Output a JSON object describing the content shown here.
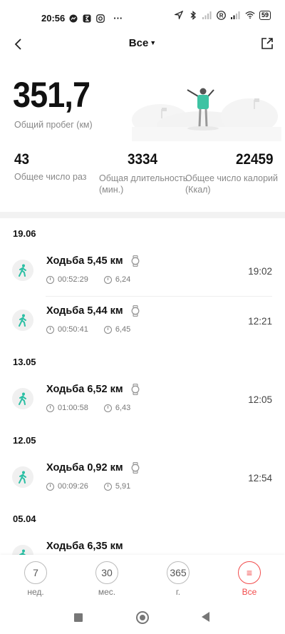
{
  "status_bar": {
    "time": "20:56",
    "more": "···",
    "battery": "59"
  },
  "header": {
    "title": "Все"
  },
  "summary": {
    "total_km": "351,7",
    "total_km_label": "Общий пробег (км)",
    "count": "43",
    "count_label": "Общее число раз",
    "duration": "3334",
    "duration_label": "Общая длительность (мин.)",
    "calories": "22459",
    "calories_label": "Общее число калорий (Ккал)"
  },
  "groups": [
    {
      "date": "19.06",
      "items": [
        {
          "title": "Ходьба 5,45 км",
          "duration": "00:52:29",
          "pace": "6,24",
          "time": "19:02"
        },
        {
          "title": "Ходьба 5,44 км",
          "duration": "00:50:41",
          "pace": "6,45",
          "time": "12:21"
        }
      ]
    },
    {
      "date": "13.05",
      "items": [
        {
          "title": "Ходьба 6,52 км",
          "duration": "01:00:58",
          "pace": "6,43",
          "time": "12:05"
        }
      ]
    },
    {
      "date": "12.05",
      "items": [
        {
          "title": "Ходьба 0,92 км",
          "duration": "00:09:26",
          "pace": "5,91",
          "time": "12:54"
        }
      ]
    },
    {
      "date": "05.04",
      "items": [
        {
          "title": "Ходьба 6,35 км",
          "duration": "",
          "pace": "",
          "time": ""
        }
      ]
    }
  ],
  "bottom_nav": [
    {
      "icon_text": "7",
      "label": "нед."
    },
    {
      "icon_text": "30",
      "label": "мес."
    },
    {
      "icon_text": "365",
      "label": "г."
    },
    {
      "icon_text": "≡",
      "label": "Все"
    }
  ],
  "colors": {
    "accent_active": "#f24b4b",
    "activity_icon": "#2bbfa4",
    "hero_shirt": "#3ec3a3"
  }
}
